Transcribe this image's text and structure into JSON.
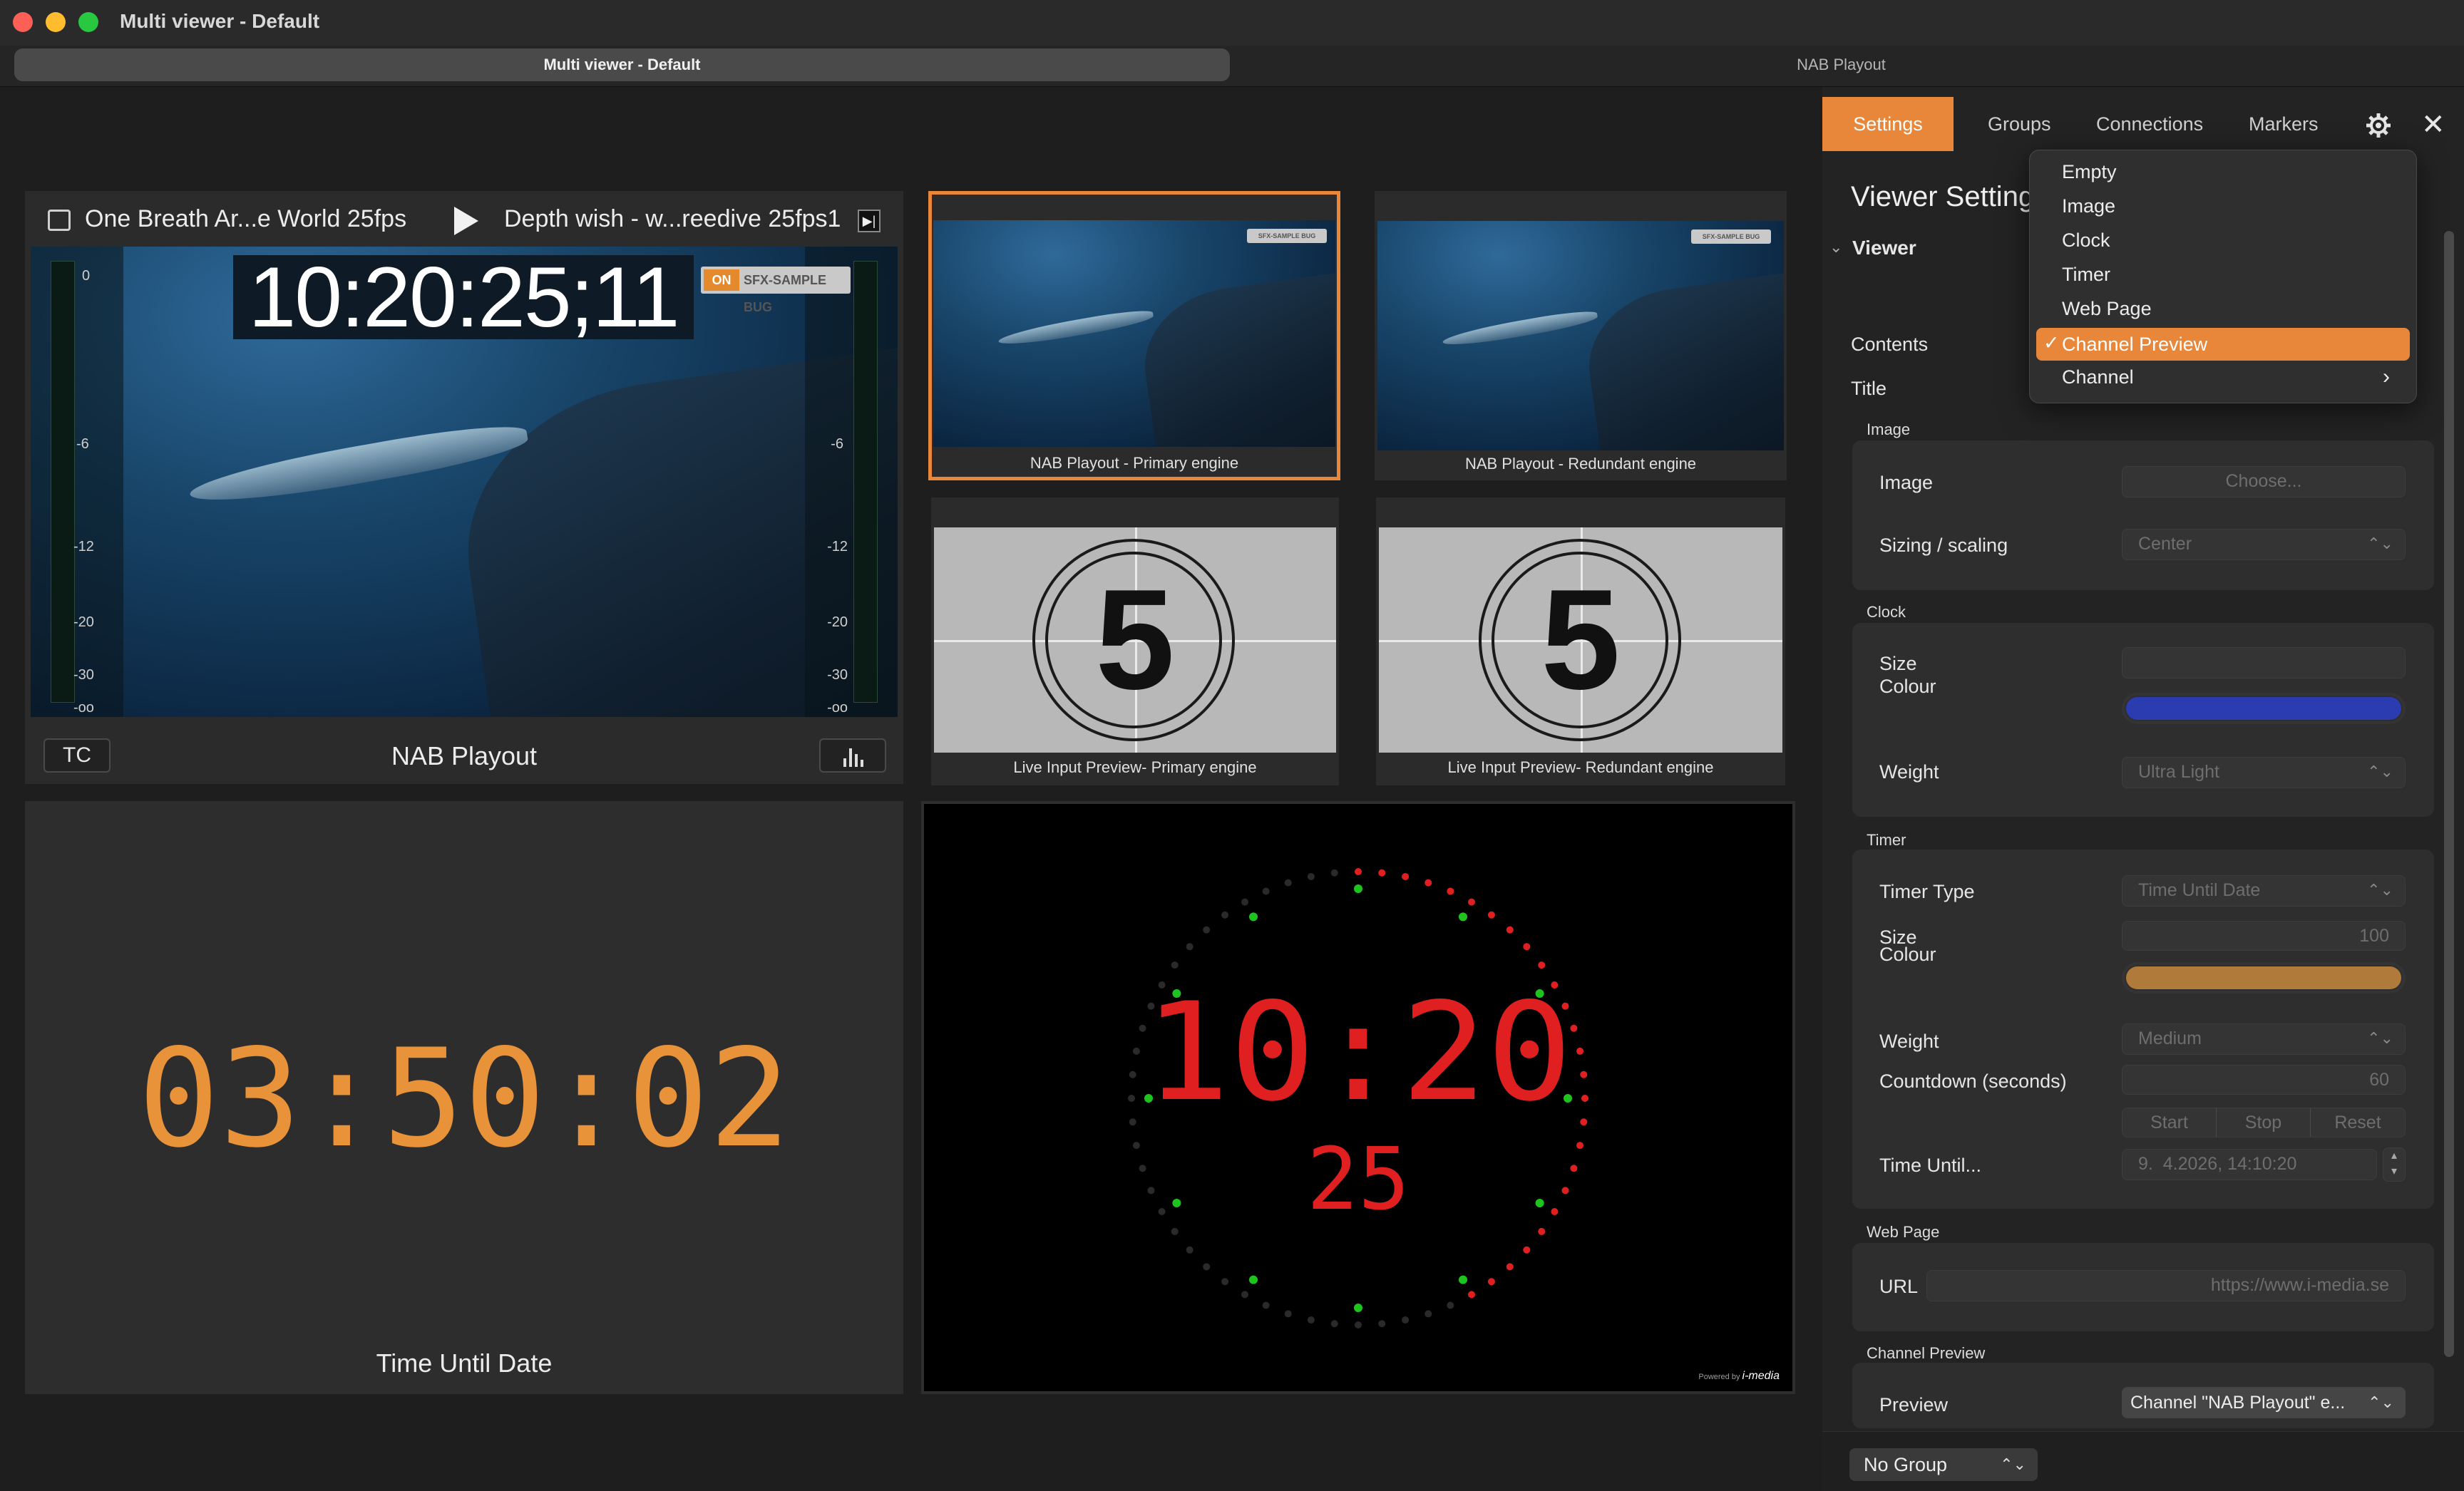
{
  "window": {
    "title": "Multi viewer - Default"
  },
  "tabs": [
    {
      "label": "Multi viewer - Default"
    },
    {
      "label": "NAB Playout"
    }
  ],
  "main_viewer": {
    "clip_current": "One Breath Ar...e World 25fps",
    "clip_next": "Depth wish - w...reedive 25fps1",
    "timecode": "10:20:25;11",
    "bug_text": "SFX-SAMPLE BUG",
    "bug_on": "ON",
    "meter_scale": [
      "0",
      "-6",
      "-12",
      "-20",
      "-30",
      "-oo"
    ],
    "tc_label": "TC",
    "channel_name": "NAB Playout"
  },
  "previews": [
    {
      "caption": "NAB Playout - Primary engine",
      "selected": true,
      "bug": "SFX-SAMPLE BUG"
    },
    {
      "caption": "NAB Playout - Redundant engine",
      "selected": false,
      "bug": "SFX-SAMPLE BUG"
    },
    {
      "caption": "Live Input Preview- Primary engine",
      "number": "5"
    },
    {
      "caption": "Live Input Preview- Redundant engine",
      "number": "5"
    }
  ],
  "timer_tile": {
    "value": "03:50:02",
    "label": "Time Until Date",
    "color": "#E8923A"
  },
  "clock_tile": {
    "time": "10:20",
    "seconds": "25",
    "color": "#E02020",
    "dot_active": "#1ec41e",
    "powered_by": "Powered by",
    "brand": "i-media"
  },
  "panel": {
    "tabs": [
      "Settings",
      "Groups",
      "Connections",
      "Markers"
    ],
    "active_tab": "Settings",
    "title": "Viewer Setting",
    "viewer_section": "Viewer",
    "contents_label": "Contents",
    "title_label": "Title",
    "image_section": {
      "header": "Image",
      "image_label": "Image",
      "choose": "Choose...",
      "sizing_label": "Sizing / scaling",
      "sizing_value": "Center"
    },
    "clock_section": {
      "header": "Clock",
      "size_label": "Size",
      "colour_label": "Colour",
      "colour": "#2B3BB0",
      "weight_label": "Weight",
      "weight_value": "Ultra Light"
    },
    "timer_section": {
      "header": "Timer",
      "type_label": "Timer Type",
      "type_value": "Time Until Date",
      "size_label": "Size",
      "size_value": "100",
      "colour_label": "Colour",
      "colour": "#B07A3A",
      "weight_label": "Weight",
      "weight_value": "Medium",
      "countdown_label": "Countdown (seconds)",
      "countdown_value": "60",
      "buttons": [
        "Start",
        "Stop",
        "Reset"
      ],
      "until_label": "Time Until...",
      "until_value": "9.  4.2026, 14:10:20"
    },
    "web_section": {
      "header": "Web Page",
      "url_label": "URL",
      "url_value": "https://www.i-media.se"
    },
    "preview_section": {
      "header": "Channel Preview",
      "preview_label": "Preview",
      "preview_value": "Channel \"NAB Playout\" e..."
    },
    "group_select": "No Group"
  },
  "dropdown": {
    "items": [
      "Empty",
      "Image",
      "Clock",
      "Timer",
      "Web Page",
      "Channel Preview",
      "Channel"
    ],
    "selected": "Channel Preview",
    "accent": "#E8873A"
  }
}
